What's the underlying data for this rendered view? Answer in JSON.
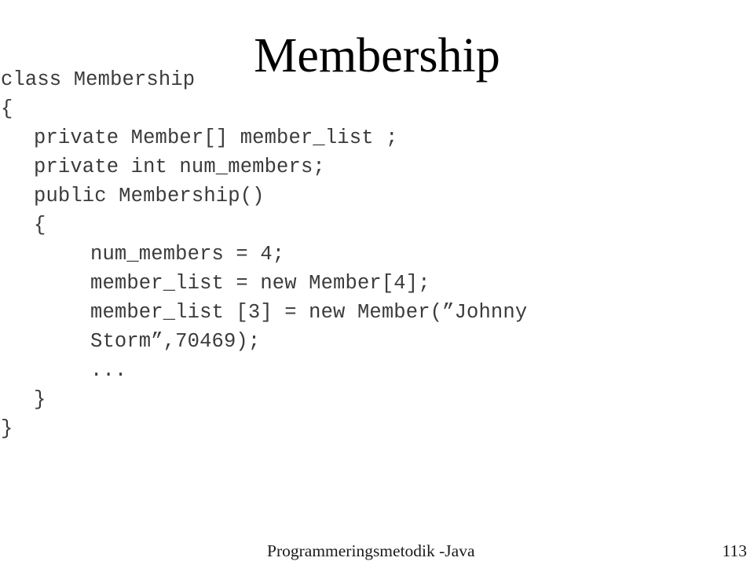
{
  "slide": {
    "title": "Membership",
    "background_color": "#ffffff",
    "code_color": "#3b3b3b",
    "title_color": "#000000"
  },
  "code": {
    "language": "Java",
    "lines": [
      {
        "indent": 0,
        "text": "class Membership"
      },
      {
        "indent": 0,
        "text": "{"
      },
      {
        "indent": 1,
        "text": "private Member[] member_list ;"
      },
      {
        "indent": 1,
        "text": "private int num_members;"
      },
      {
        "indent": 1,
        "text": "public Membership()"
      },
      {
        "indent": 1,
        "text": "{"
      },
      {
        "indent": 2,
        "text": "num_members = 4;"
      },
      {
        "indent": 2,
        "text": "member_list = new Member[4];"
      },
      {
        "indent": 2,
        "text": "member_list [3] = new Member(”Johnny"
      },
      {
        "indent": 2,
        "text": "Storm”,70469);"
      },
      {
        "indent": 2,
        "text": "..."
      },
      {
        "indent": 1,
        "text": "}"
      },
      {
        "indent": 0,
        "text": "}"
      }
    ]
  },
  "footer": {
    "course": "Programmeringsmetodik -Java",
    "page_number": "113"
  }
}
